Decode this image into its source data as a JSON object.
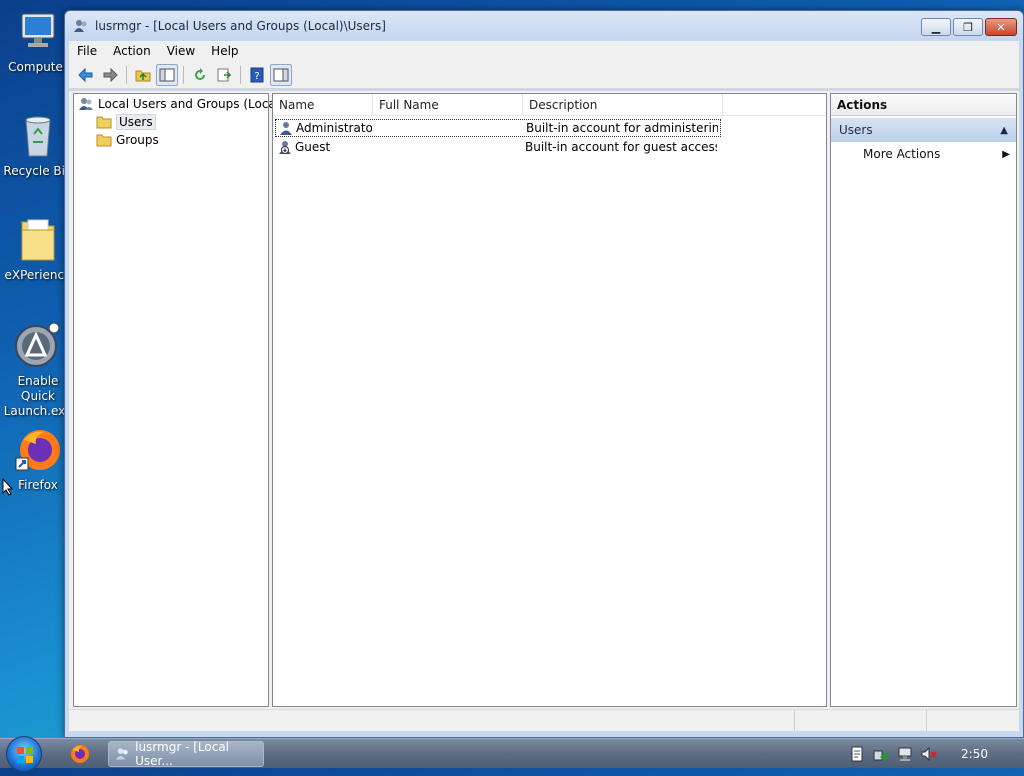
{
  "desktop": {
    "icons": [
      {
        "label": "Computer"
      },
      {
        "label": "Recycle Bin"
      },
      {
        "label": "eXPerience"
      },
      {
        "label": "Enable Quick Launch.exe"
      },
      {
        "label": "Firefox"
      }
    ]
  },
  "window": {
    "title": "lusrmgr - [Local Users and Groups (Local)\\Users]",
    "menu": {
      "file": "File",
      "action": "Action",
      "view": "View",
      "help": "Help"
    },
    "tree": {
      "root": "Local Users and Groups (Local)",
      "items": [
        {
          "label": "Users"
        },
        {
          "label": "Groups"
        }
      ]
    },
    "list": {
      "columns": [
        "Name",
        "Full Name",
        "Description"
      ],
      "rows": [
        {
          "name": "Administrator",
          "full_name": "",
          "description": "Built-in account for administering..."
        },
        {
          "name": "Guest",
          "full_name": "",
          "description": "Built-in account for guest access t..."
        }
      ]
    },
    "actions": {
      "header": "Actions",
      "group": "Users",
      "more": "More Actions"
    }
  },
  "taskbar": {
    "task_label": "lusrmgr - [Local User...",
    "clock": "2:50"
  },
  "colors": {
    "accent": "#c9d8ee",
    "selection": "#bcd0ea"
  }
}
